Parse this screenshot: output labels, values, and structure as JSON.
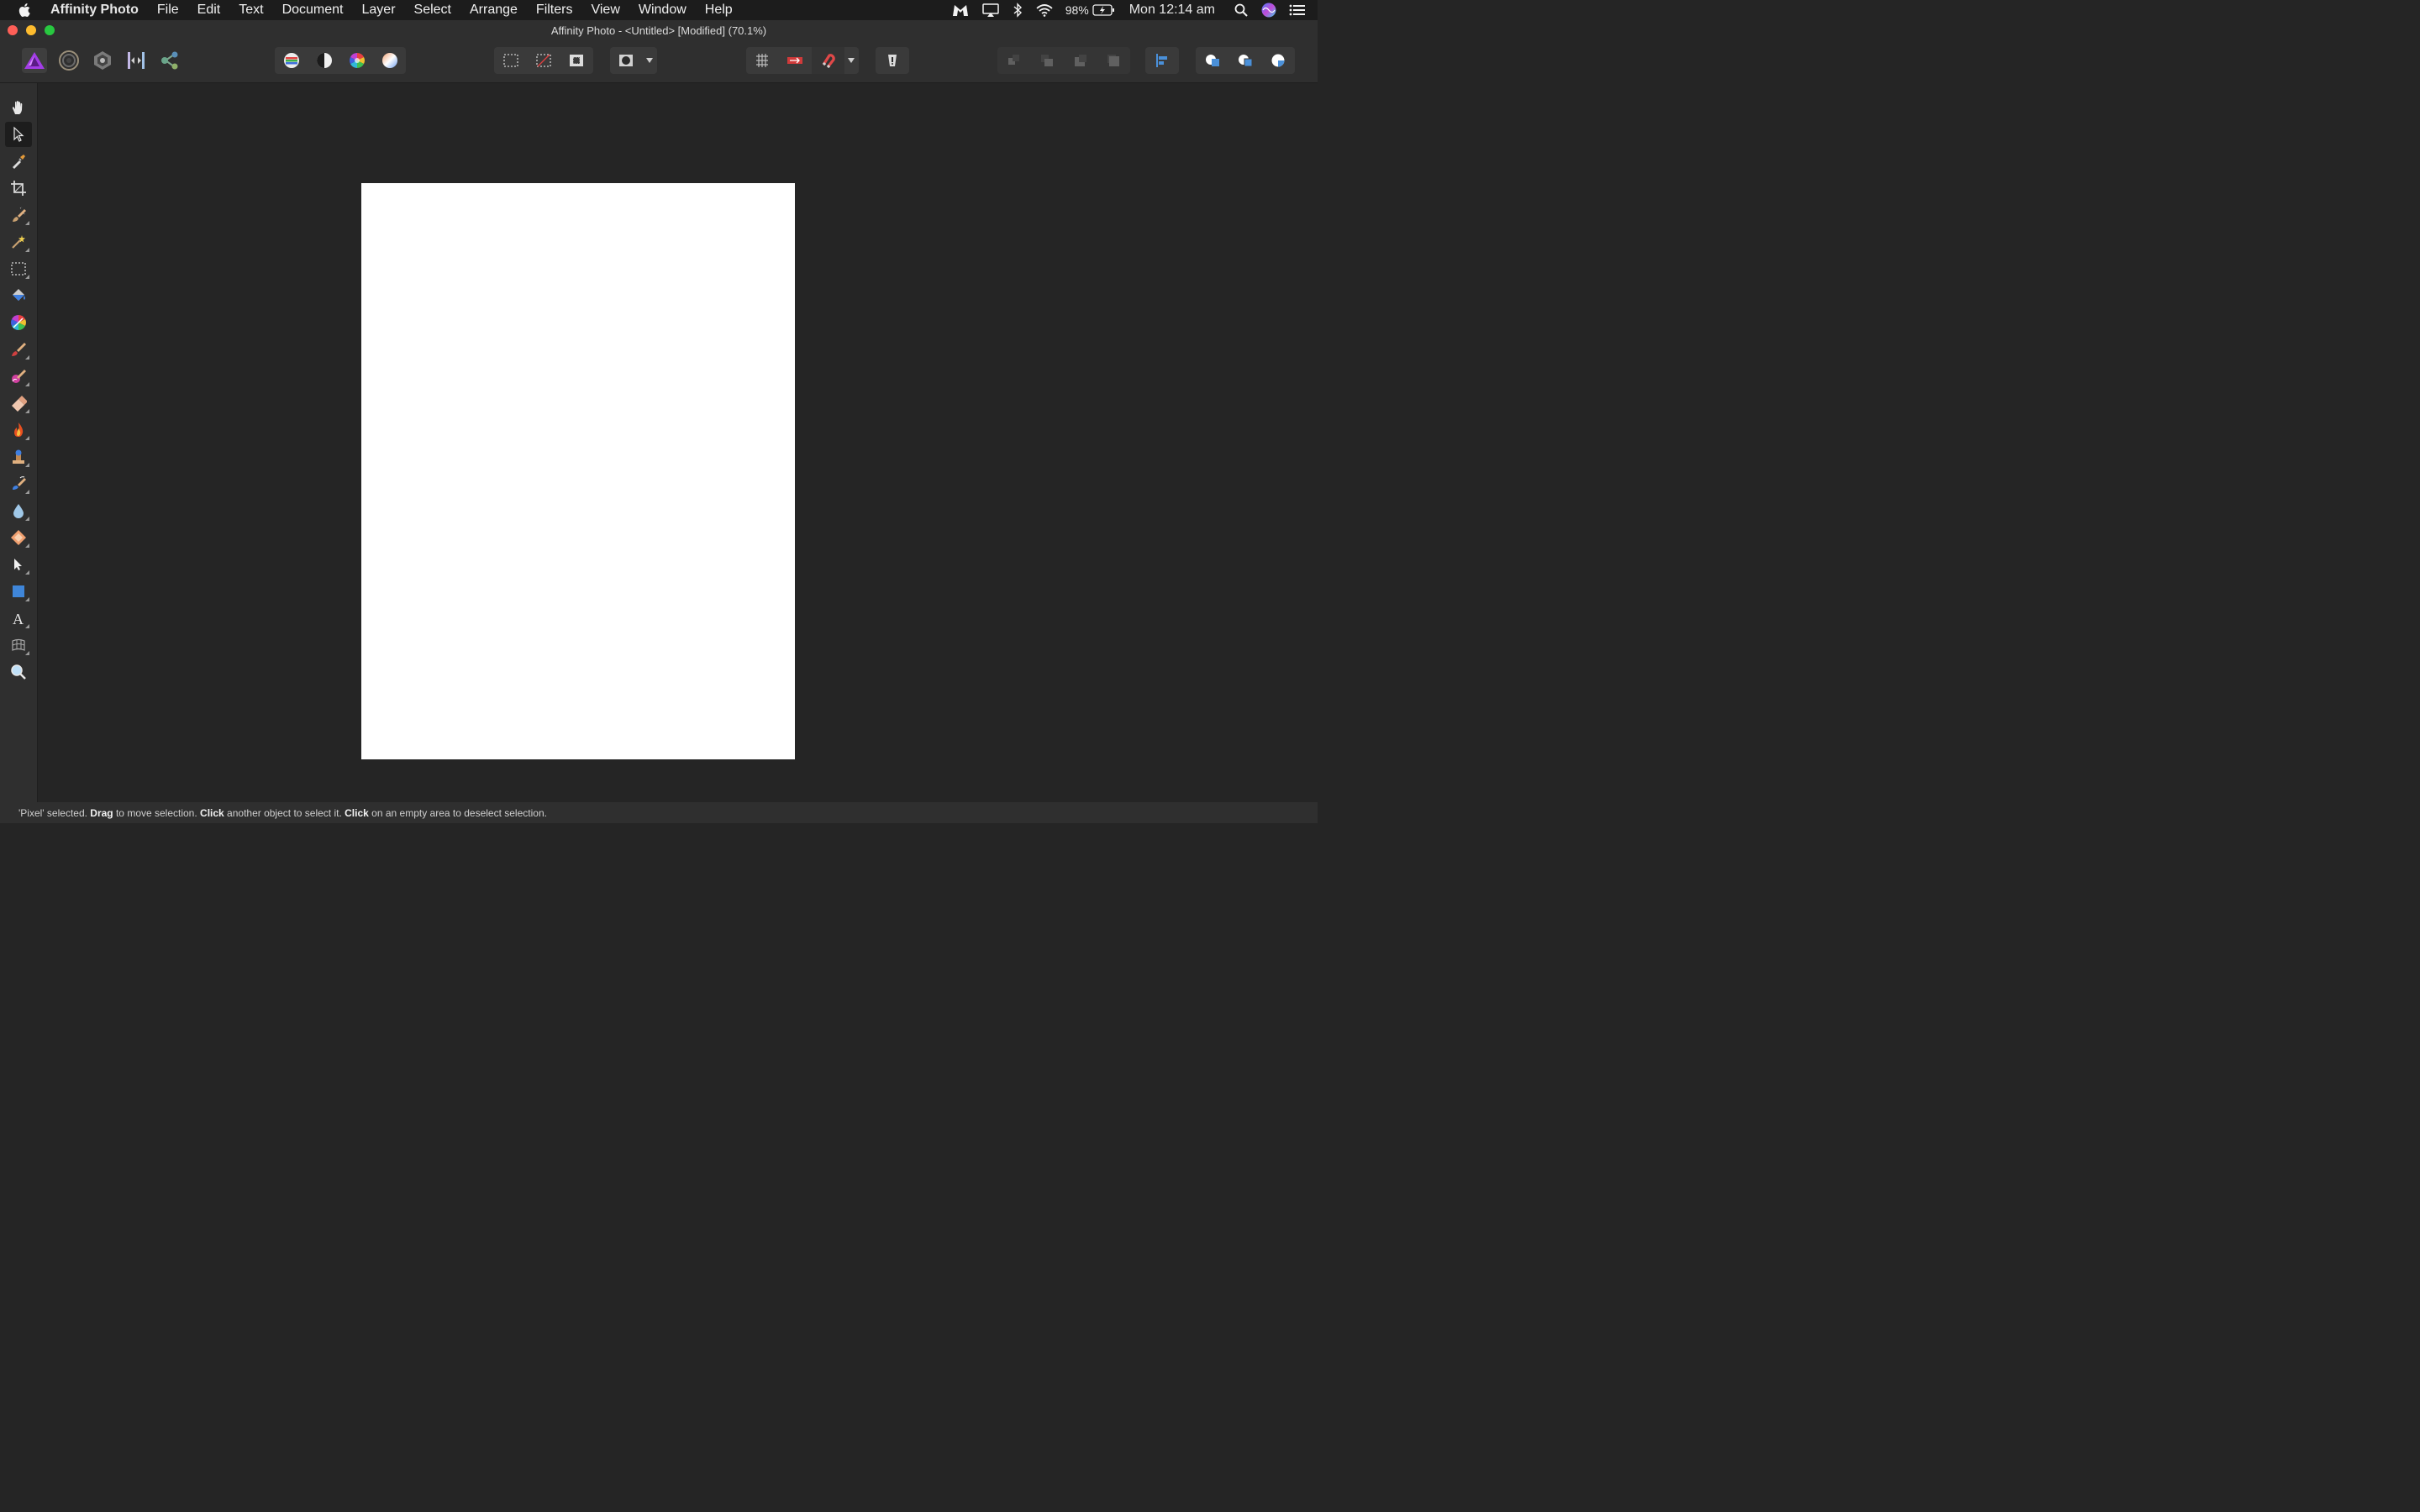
{
  "menubar": {
    "app_name": "Affinity Photo",
    "items": [
      "File",
      "Edit",
      "Text",
      "Document",
      "Layer",
      "Select",
      "Arrange",
      "Filters",
      "View",
      "Window",
      "Help"
    ],
    "battery": "98%",
    "clock": "Mon 12:14 am"
  },
  "window": {
    "title": "Affinity Photo - <Untitled> [Modified] (70.1%)"
  },
  "toolbar": {
    "personas": [
      "photo-persona-icon",
      "liquify-persona-icon",
      "develop-persona-icon",
      "tone-mapping-persona-icon",
      "export-persona-icon"
    ],
    "active_persona": "photo-persona-icon"
  },
  "tools": {
    "items": [
      "hand-tool",
      "move-tool",
      "color-picker-tool",
      "crop-tool",
      "selection-brush-tool",
      "flood-select-tool",
      "marquee-tool",
      "flood-fill-tool",
      "gradient-tool",
      "paint-brush-tool",
      "color-replacement-tool",
      "erase-brush-tool",
      "dodge-tool",
      "clone-tool",
      "inpainting-tool",
      "blur-tool",
      "sponge-tool",
      "node-tool",
      "rectangle-tool",
      "artistic-text-tool",
      "mesh-warp-tool",
      "zoom-tool"
    ],
    "active": "move-tool"
  },
  "status": {
    "part1": "'Pixel' selected. ",
    "bold1": "Drag",
    "part2": " to move selection. ",
    "bold2": "Click",
    "part3": " another object to select it. ",
    "bold3": "Click",
    "part4": " on an empty area to deselect selection."
  },
  "colors": {
    "accent": "#a23ce6",
    "canvas": "#252525",
    "document": "#ffffff"
  }
}
